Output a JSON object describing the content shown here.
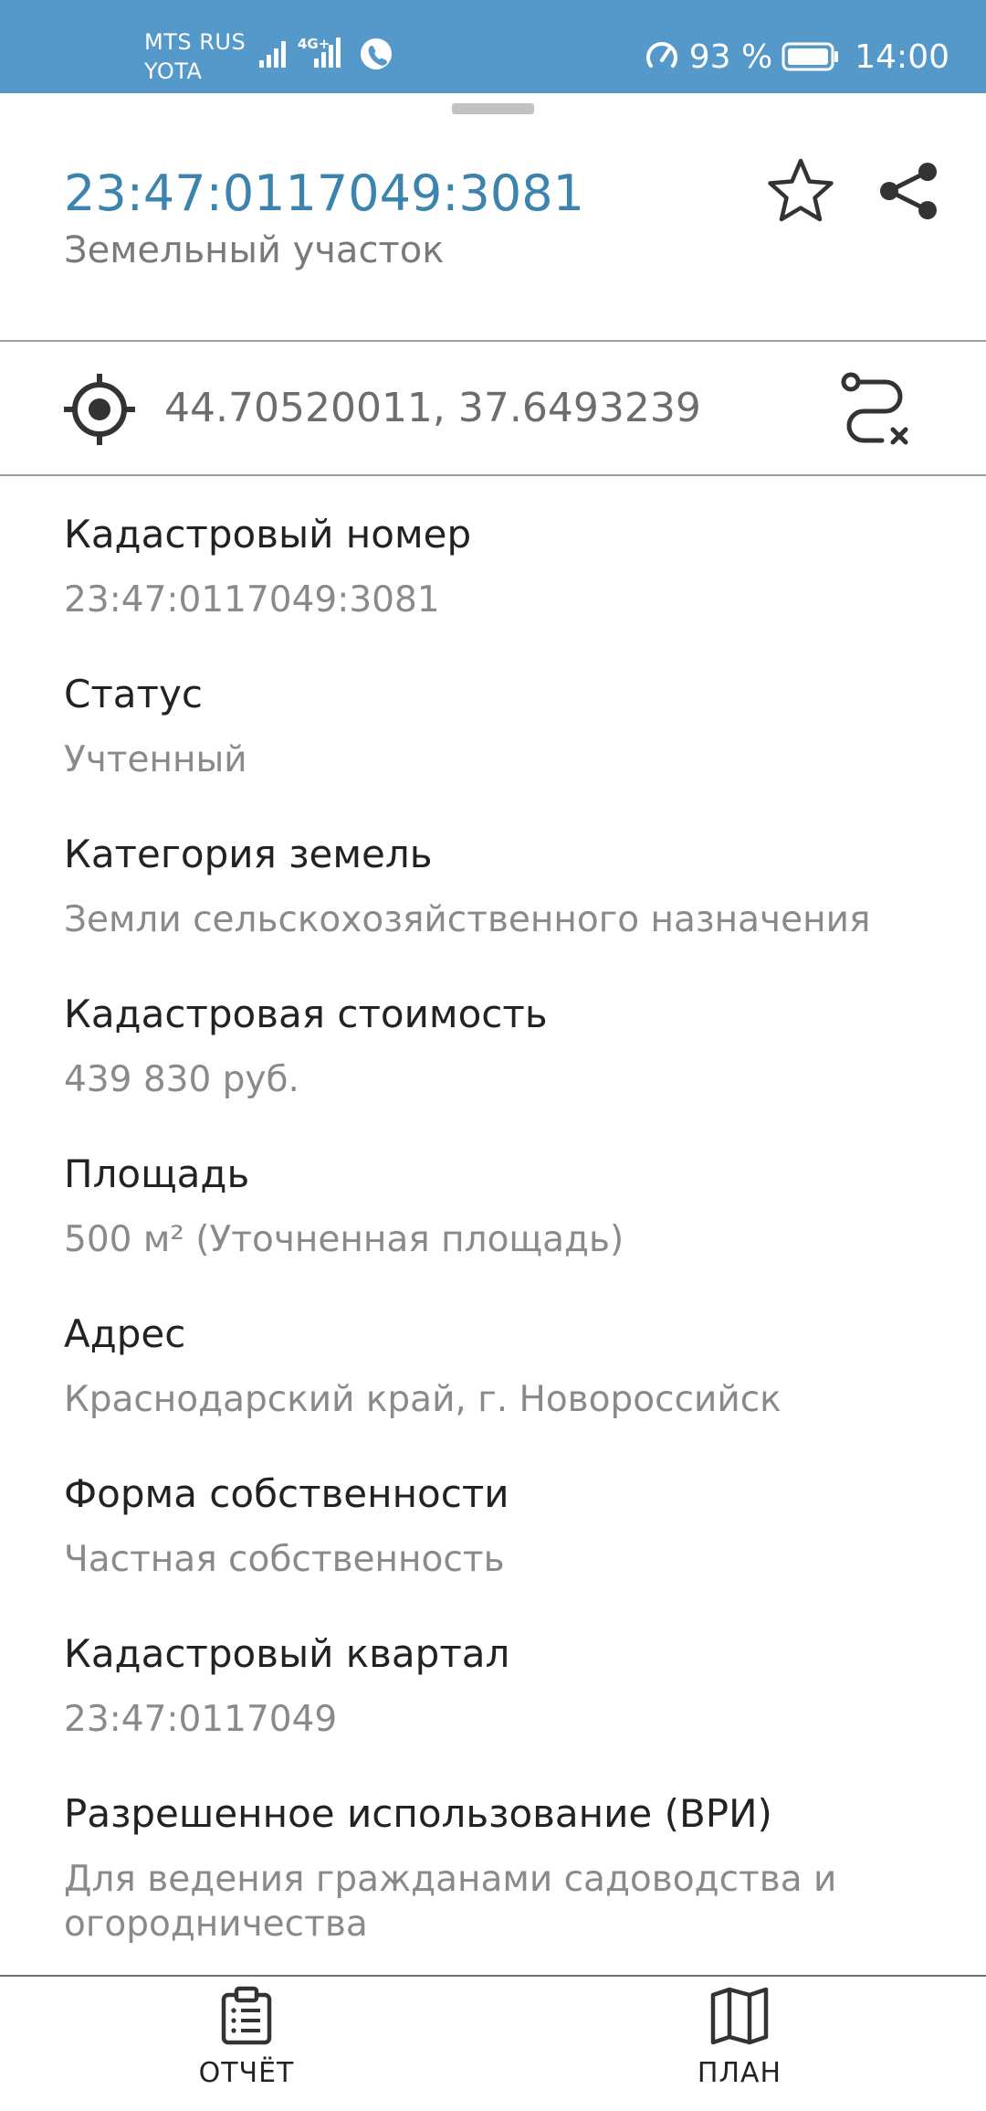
{
  "status_bar": {
    "carrier_line1": "MTS RUS",
    "carrier_line2": "YOTA",
    "network_badge": "4G+",
    "battery_percent": "93 %",
    "battery_level": 0.93,
    "time": "14:00",
    "background_color": "#5499c9"
  },
  "header": {
    "cadastral_number": "23:47:0117049:3081",
    "object_type": "Земельный участок",
    "accent_color": "#3c83ae",
    "actions": [
      "star-icon",
      "share-icon"
    ]
  },
  "location": {
    "coordinates": "44.70520011, 37.6493239",
    "icons": [
      "target-icon",
      "route-clear-icon"
    ]
  },
  "properties": [
    {
      "label": "Кадастровый номер",
      "value": "23:47:0117049:3081"
    },
    {
      "label": "Статус",
      "value": "Учтенный"
    },
    {
      "label": "Категория земель",
      "value": "Земли сельскохозяйственного назначения"
    },
    {
      "label": "Кадастровая стоимость",
      "value": "439 830 руб."
    },
    {
      "label": "Площадь",
      "value": "500 м² (Уточненная площадь)"
    },
    {
      "label": "Адрес",
      "value": "Краснодарский край, г. Новороссийск"
    },
    {
      "label": "Форма собственности",
      "value": "Частная собственность"
    },
    {
      "label": "Кадастровый квартал",
      "value": "23:47:0117049"
    },
    {
      "label": "Разрешенное использование (ВРИ)",
      "value_line1": "Для ведения гражданами садоводства и",
      "value_line2": "огородничества"
    }
  ],
  "bottom_nav": {
    "report_label": "ОТЧЁТ",
    "plan_label": "ПЛАН"
  }
}
